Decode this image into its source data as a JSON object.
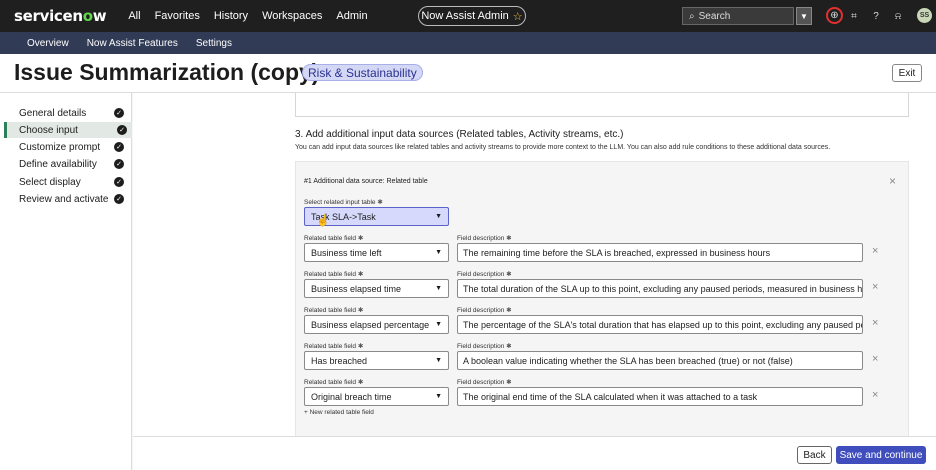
{
  "topbar": {
    "logo_a": "servicen",
    "logo_o": "o",
    "logo_b": "w",
    "nav": [
      "All",
      "Favorites",
      "History",
      "Workspaces",
      "Admin"
    ],
    "assistant_pill": "Now Assist Admin",
    "search_placeholder": "Search",
    "avatar_initials": "SS"
  },
  "subnav": [
    "Overview",
    "Now Assist Features",
    "Settings"
  ],
  "header": {
    "title": "Issue Summarization (copy)",
    "badge": "Risk & Sustainability",
    "exit_label": "Exit"
  },
  "sidebar": {
    "steps": [
      {
        "label": "General details",
        "done": true
      },
      {
        "label": "Choose input",
        "done": true,
        "active": true
      },
      {
        "label": "Customize prompt",
        "done": true
      },
      {
        "label": "Define availability",
        "done": true
      },
      {
        "label": "Select display",
        "done": true
      },
      {
        "label": "Review and activate",
        "done": true
      }
    ]
  },
  "main": {
    "section_title": "3. Add additional input data sources (Related tables, Activity streams, etc.)",
    "section_desc": "You can add input data sources like related tables and activity streams to provide more context to the LLM. You can also add rule conditions to these additional data sources.",
    "card": {
      "title": "#1 Additional data source: Related table",
      "select_label": "Select related input table",
      "select_value": "Task SLA->Task",
      "field_label": "Related table field",
      "desc_label": "Field description",
      "rows": [
        {
          "field": "Business time left",
          "desc": "The remaining time before the SLA is breached, expressed in business hours"
        },
        {
          "field": "Business elapsed time",
          "desc": "The total duration of the SLA up to this point, excluding any paused periods, measured in business hours"
        },
        {
          "field": "Business elapsed percentage",
          "desc": "The percentage of the SLA's total duration that has elapsed up to this point, excluding any paused periods"
        },
        {
          "field": "Has breached",
          "desc": "A boolean value indicating whether the SLA has been breached (true) or not (false)"
        },
        {
          "field": "Original breach time",
          "desc": "The original end time of the SLA calculated when it was attached to a task"
        }
      ],
      "new_field_label": "+ New related table field"
    }
  },
  "footer": {
    "back_label": "Back",
    "save_label": "Save and continue"
  },
  "colors": {
    "accent": "#3f4dbd",
    "subnav": "#323b55",
    "topbar": "#1f1f1f",
    "logo_o": "#62d84e"
  }
}
